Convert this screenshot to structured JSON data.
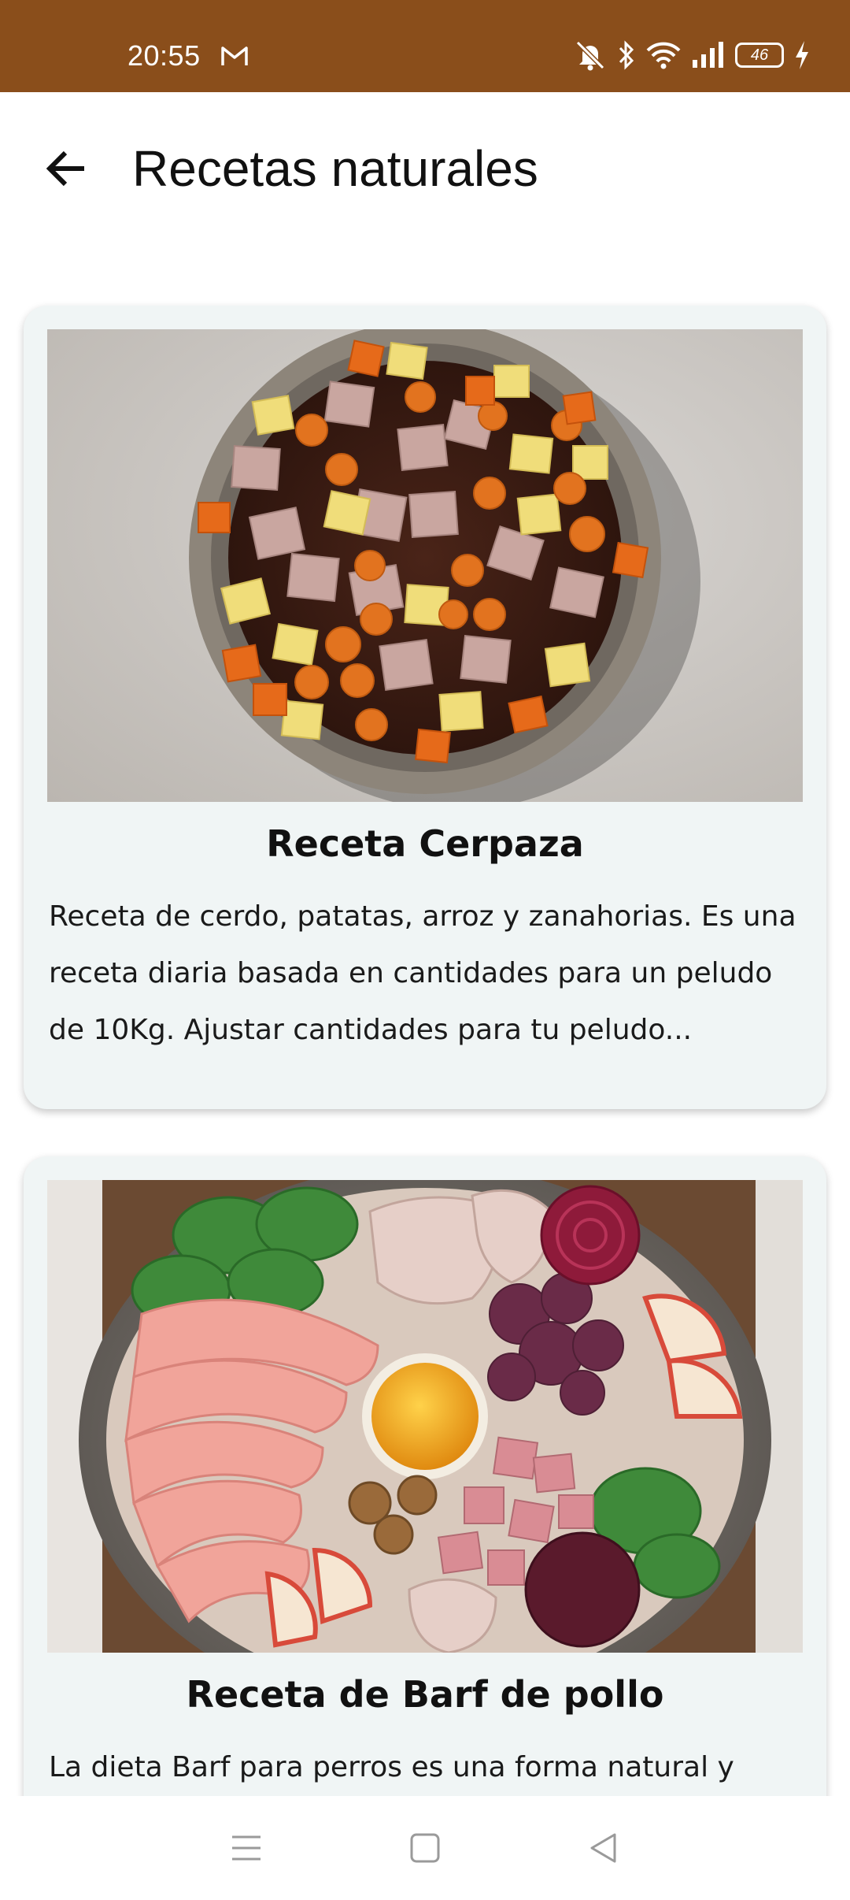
{
  "status_bar": {
    "time": "20:55",
    "battery": "46",
    "background_color": "#8a4e1b",
    "icons": [
      "gmail-icon",
      "mute-icon",
      "bluetooth-icon",
      "wifi-icon",
      "signal-icon",
      "battery-icon",
      "charging-icon"
    ]
  },
  "app_bar": {
    "back_icon": "arrow-left-icon",
    "title": "Recetas naturales"
  },
  "recipes": [
    {
      "title": "Receta Cerpaza",
      "description": "Receta de cerdo, patatas, arroz y zanahorias. Es una receta diaria basada en cantidades para un peludo de 10Kg. Ajustar cantidades para tu peludo..."
    },
    {
      "title": "Receta de Barf de pollo",
      "description": "La dieta Barf para perros es una forma natural y"
    }
  ],
  "nav_bar": {
    "icons": [
      "menu-icon",
      "home-square-icon",
      "back-triangle-icon"
    ]
  }
}
